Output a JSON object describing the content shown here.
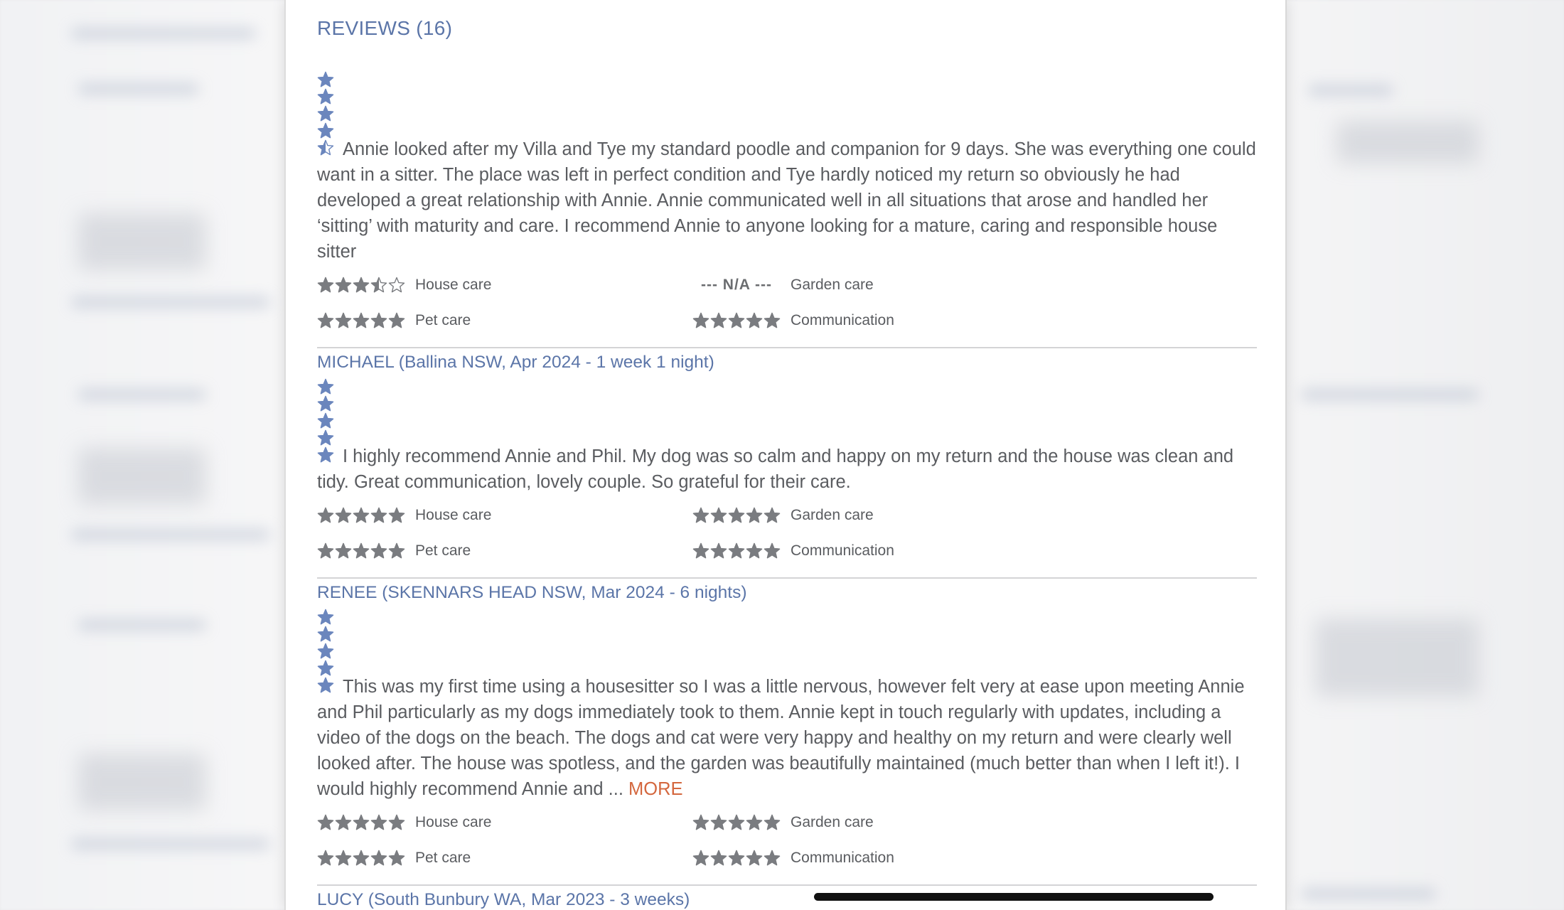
{
  "colors": {
    "accent": "#5b75a8",
    "star_overall": "#6b86bd",
    "star_category": "#7a7c80",
    "more_link": "#d4673e"
  },
  "reviews_heading": "REVIEWS (16)",
  "reviews": [
    {
      "overall_rating": 4.5,
      "text": "Annie looked after my Villa and Tye my standard poodle and companion for 9 days. She was everything one could want in a sitter. The place was left in perfect condition and Tye hardly noticed my return so obviously he had developed a great relationship with Annie. Annie communicated well in all situations that arose and handled her ‘sitting’ with maturity and care. I recommend Annie to anyone looking for a mature, caring and responsible house sitter",
      "more_label": "",
      "ratings": {
        "house_care": {
          "label": "House care",
          "value": 3.5
        },
        "garden_care": {
          "label": "Garden care",
          "value": null,
          "na_text": "--- N/A ---"
        },
        "pet_care": {
          "label": "Pet care",
          "value": 5
        },
        "communication": {
          "label": "Communication",
          "value": 5
        }
      },
      "reviewer": "MICHAEL (Ballina NSW, Apr 2024 - 1 week 1 night)"
    },
    {
      "overall_rating": 5,
      "text": "I highly recommend Annie and Phil. My dog was so calm and happy on my return and the house was clean and tidy. Great communication, lovely couple. So grateful for their care.",
      "more_label": "",
      "ratings": {
        "house_care": {
          "label": "House care",
          "value": 5
        },
        "garden_care": {
          "label": "Garden care",
          "value": 5
        },
        "pet_care": {
          "label": "Pet care",
          "value": 5
        },
        "communication": {
          "label": "Communication",
          "value": 5
        }
      },
      "reviewer": "RENEE (SKENNARS HEAD NSW, Mar 2024 - 6 nights)"
    },
    {
      "overall_rating": 5,
      "text": "This was my first time using a housesitter so I was a little nervous, however felt very at ease upon meeting Annie and Phil particularly as my dogs immediately took to them. Annie kept in touch regularly with updates, including a video of the dogs on the beach. The dogs and cat were very happy and healthy on my return and were clearly well looked after. The house was spotless, and the garden was beautifully maintained (much better than when I left it!). I would highly recommend Annie and ...",
      "more_label": "MORE",
      "ratings": {
        "house_care": {
          "label": "House care",
          "value": 5
        },
        "garden_care": {
          "label": "Garden care",
          "value": 5
        },
        "pet_care": {
          "label": "Pet care",
          "value": 5
        },
        "communication": {
          "label": "Communication",
          "value": 5
        }
      },
      "reviewer": "LUCY (South Bunbury WA, Mar 2023 - 3 weeks)"
    }
  ]
}
